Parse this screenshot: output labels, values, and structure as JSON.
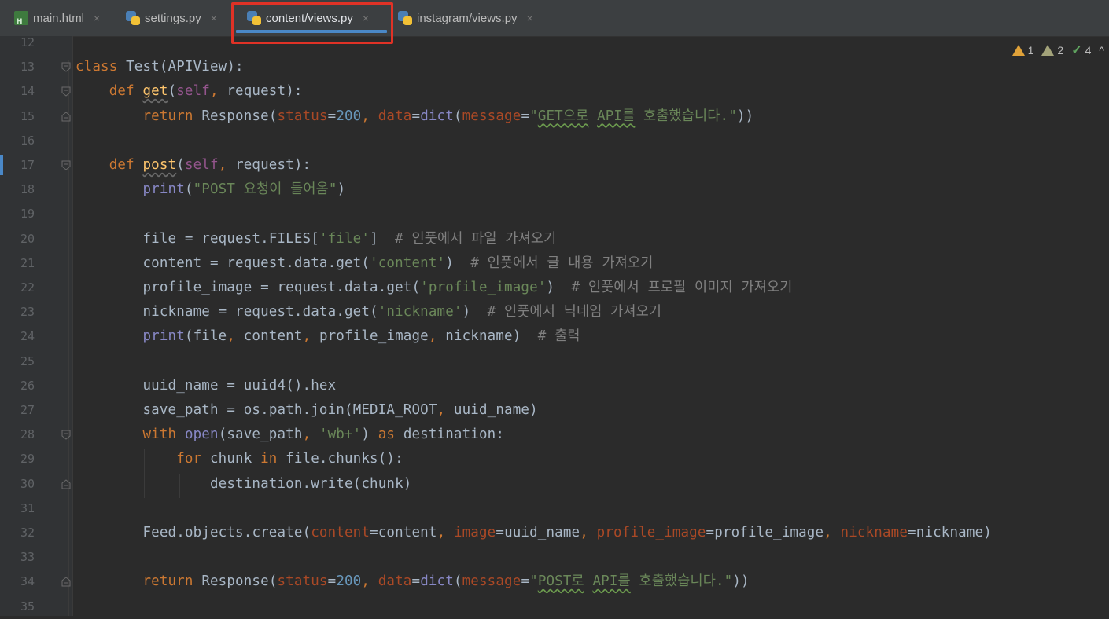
{
  "tabs": [
    {
      "label": "main.html",
      "icon": "html-file-icon",
      "active": false
    },
    {
      "label": "settings.py",
      "icon": "python-file-icon",
      "active": false
    },
    {
      "label": "content/views.py",
      "icon": "python-file-icon",
      "active": true
    },
    {
      "label": "instagram/views.py",
      "icon": "python-file-icon",
      "active": false
    }
  ],
  "tab_close_glyph": "×",
  "inspections": {
    "warnings": "1",
    "weak_warnings": "2",
    "ok": "4"
  },
  "colors": {
    "background": "#2b2b2b",
    "gutter": "#313335",
    "keyword": "#cc7832",
    "string": "#6a8759",
    "number": "#6897bb",
    "builtin": "#8888c6",
    "function": "#ffc66d",
    "comment": "#808080",
    "highlight_box": "#e03226",
    "active_tab_underline": "#4a88c7"
  },
  "editor": {
    "language": "python",
    "lines": [
      {
        "n": "12",
        "text": ""
      },
      {
        "n": "13",
        "text": "class Test(APIView):"
      },
      {
        "n": "14",
        "text": "    def get(self, request):"
      },
      {
        "n": "15",
        "text": "        return Response(status=200, data=dict(message=\"GET으로 API를 호출했습니다.\"))"
      },
      {
        "n": "16",
        "text": ""
      },
      {
        "n": "17",
        "text": "    def post(self, request):"
      },
      {
        "n": "18",
        "text": "        print(\"POST 요청이 들어옴\")"
      },
      {
        "n": "19",
        "text": ""
      },
      {
        "n": "20",
        "text": "        file = request.FILES['file']  # 인풋에서 파일 가져오기"
      },
      {
        "n": "21",
        "text": "        content = request.data.get('content')  # 인풋에서 글 내용 가져오기"
      },
      {
        "n": "22",
        "text": "        profile_image = request.data.get('profile_image')  # 인풋에서 프로필 이미지 가져오기"
      },
      {
        "n": "23",
        "text": "        nickname = request.data.get('nickname')  # 인풋에서 닉네임 가져오기"
      },
      {
        "n": "24",
        "text": "        print(file, content, profile_image, nickname)  # 출력"
      },
      {
        "n": "25",
        "text": ""
      },
      {
        "n": "26",
        "text": "        uuid_name = uuid4().hex"
      },
      {
        "n": "27",
        "text": "        save_path = os.path.join(MEDIA_ROOT, uuid_name)"
      },
      {
        "n": "28",
        "text": "        with open(save_path, 'wb+') as destination:"
      },
      {
        "n": "29",
        "text": "            for chunk in file.chunks():"
      },
      {
        "n": "30",
        "text": "                destination.write(chunk)"
      },
      {
        "n": "31",
        "text": ""
      },
      {
        "n": "32",
        "text": "        Feed.objects.create(content=content, image=uuid_name, profile_image=profile_image, nickname=nickname)"
      },
      {
        "n": "33",
        "text": ""
      },
      {
        "n": "34",
        "text": "        return Response(status=200, data=dict(message=\"POST로 API를 호출했습니다.\"))"
      },
      {
        "n": "35",
        "text": ""
      }
    ]
  }
}
